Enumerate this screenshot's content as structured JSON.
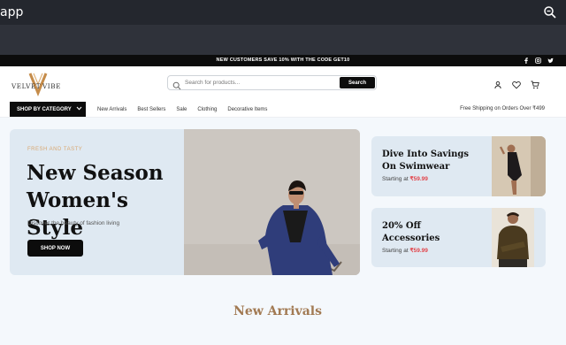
{
  "browser": {
    "title": "app"
  },
  "promo_bar": {
    "text": "NEW CUSTOMERS SAVE 10% WITH THE CODE GET10"
  },
  "brand": {
    "logo_text": "VelvetVibe"
  },
  "search": {
    "placeholder": "Search for products...",
    "button_label": "Search"
  },
  "nav": {
    "category_button": "SHOP BY CATEGORY",
    "links": [
      "New Arrivals",
      "Best Sellers",
      "Sale",
      "Clothing",
      "Decorative Items"
    ],
    "shipping_note": "Free Shipping on Orders Over ₹499"
  },
  "hero": {
    "eyebrow": "FRESH AND TASTY",
    "title": "New Season Women's Style",
    "subtitle": "Discover the beauty of fashion living",
    "cta": "SHOP NOW"
  },
  "promo_cards": [
    {
      "title": "Dive Into Savings On Swimwear",
      "price_prefix": "Starting at",
      "price": "₹59.99"
    },
    {
      "title": "20% Off Accessories",
      "price_prefix": "Starting at",
      "price": "₹59.99"
    }
  ],
  "section": {
    "title": "New Arrivals"
  },
  "colors": {
    "accent": "#e2444b",
    "eyebrow": "#d9a871",
    "section_title": "#a27a53",
    "hero_bg": "#dfe9f2"
  }
}
